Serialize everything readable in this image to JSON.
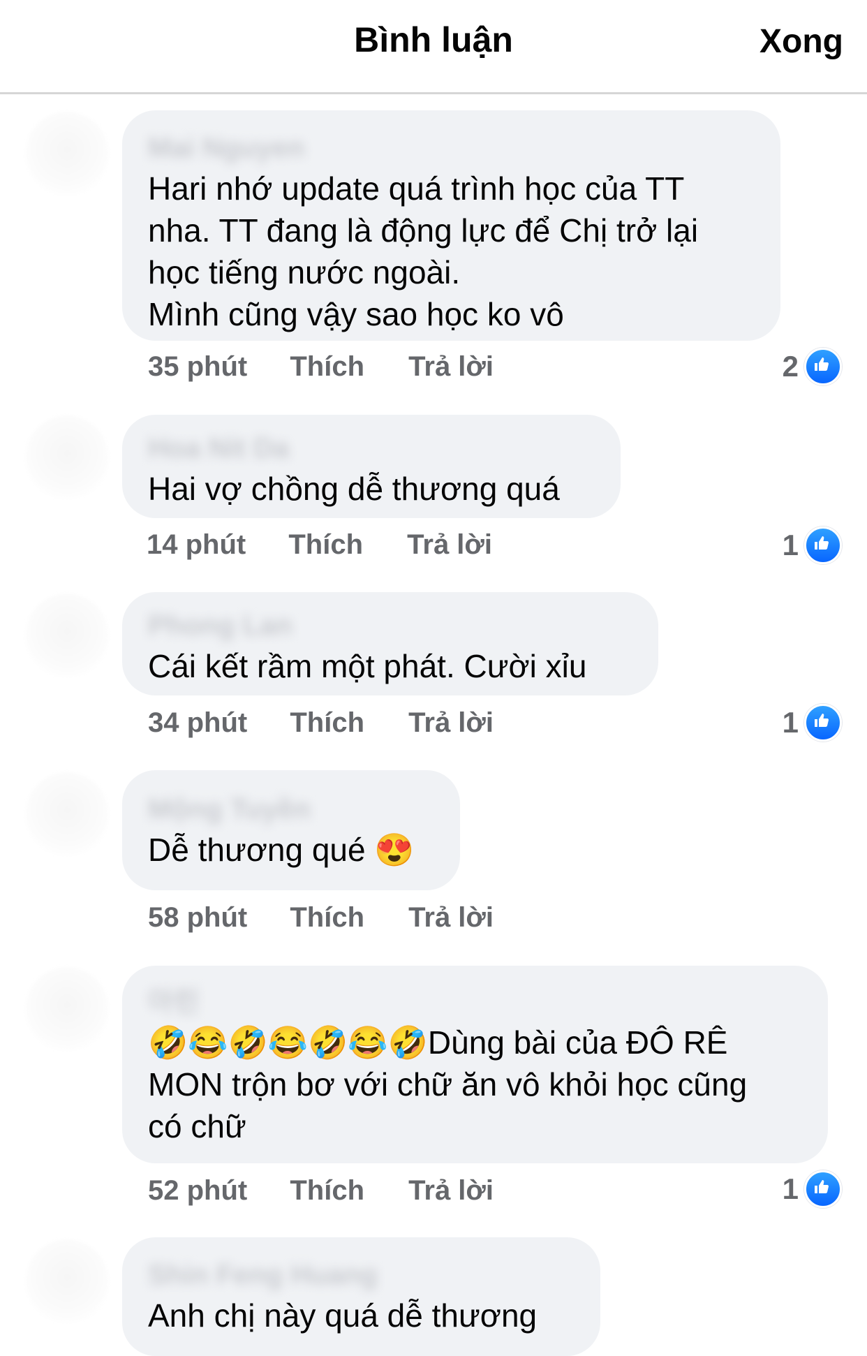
{
  "header": {
    "title": "Bình luận",
    "done_label": "Xong"
  },
  "comments": [
    {
      "author": "Mai Nguyen",
      "text": "Hari nhớ update quá trình học của TT\nnha. TT đang là động lực để Chị trở lại\nhọc tiếng nước ngoài.\nMình cũng vậy sao học ko vô",
      "time": "35 phút",
      "like_label": "Thích",
      "reply_label": "Trả lời",
      "reactions": "2"
    },
    {
      "author": "Hoa Nit Da",
      "text": "Hai vợ chồng dễ thương quá",
      "time": "14 phút",
      "like_label": "Thích",
      "reply_label": "Trả lời",
      "reactions": "1"
    },
    {
      "author": "Phong Lan",
      "text": "Cái kết rầm một phát. Cười xỉu",
      "time": "34 phút",
      "like_label": "Thích",
      "reply_label": "Trả lời",
      "reactions": "1"
    },
    {
      "author": "Mộng Tuyền",
      "text": "Dễ thương qué 😍",
      "time": "58 phút",
      "like_label": "Thích",
      "reply_label": "Trả lời",
      "reactions": ""
    },
    {
      "author": "아린",
      "text": "🤣😂🤣😂🤣😂🤣Dùng bài của ĐÔ RÊ\nMON trộn bơ với chữ ăn vô khỏi học cũng\ncó chữ",
      "time": "52 phút",
      "like_label": "Thích",
      "reply_label": "Trả lời",
      "reactions": "1"
    },
    {
      "author": "Shin Feng Huang",
      "text": "Anh chị này quá dễ thương"
    }
  ],
  "icons": {
    "like": "like-thumb-icon"
  },
  "colors": {
    "bubble": "#f0f2f5",
    "meta_text": "#65676b",
    "like_blue": "#0866ff"
  }
}
